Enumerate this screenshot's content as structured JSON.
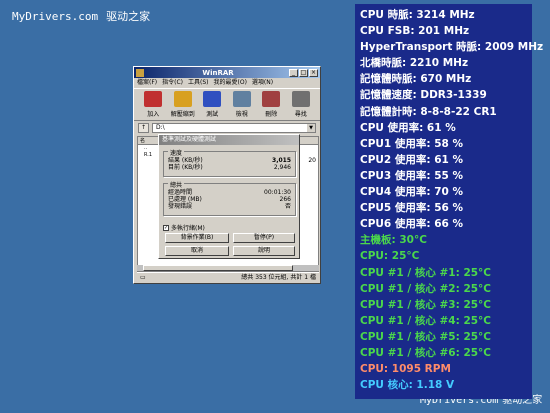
{
  "watermark": {
    "top_url": "MyDrivers.com",
    "top_cn": "驱动之家",
    "bottom_url": "MyDrivers.com",
    "bottom_cn": "驱动之家"
  },
  "winrar": {
    "title": "WinRAR",
    "menu": [
      "檔案(F)",
      "指令(C)",
      "工具(S)",
      "我的最愛(O)",
      "選項(N)"
    ],
    "toolbar": [
      {
        "label": "加入",
        "icon": "add-icon",
        "color": "#c03030"
      },
      {
        "label": "解壓縮到",
        "icon": "extract-icon",
        "color": "#d8a020"
      },
      {
        "label": "測試",
        "icon": "test-icon",
        "color": "#3050c0"
      },
      {
        "label": "檢視",
        "icon": "view-icon",
        "color": "#6080a0"
      },
      {
        "label": "刪除",
        "icon": "delete-icon",
        "color": "#a04040"
      },
      {
        "label": "尋找",
        "icon": "find-icon",
        "color": "#707070"
      }
    ],
    "path": "D:\\",
    "list_header": "名",
    "list_rows": [
      "..",
      "R.1"
    ],
    "right_col": "20",
    "status_left": "",
    "status_right": "總共 353 位元組, 共計 1 檔"
  },
  "benchmark": {
    "title": "基準測試及硬體測試",
    "speed_group": "速度",
    "result_label": "結果 (KB/秒)",
    "result_value": "3,015",
    "current_label": "目前 (KB/秒)",
    "current_value": "2,946",
    "totals_group": "總共",
    "elapsed_label": "經過時間",
    "elapsed_value": "00:01:30",
    "processed_label": "已處理 (MB)",
    "processed_value": "266",
    "errors_label": "發現錯誤",
    "errors_value": "否",
    "multithread_label": "多執行緒(M)",
    "multithread_checked": true,
    "background_button": "背景作業(B)",
    "pause_button": "暫停(P)",
    "cancel_button": "取消",
    "help_button": "說明"
  },
  "stats": [
    {
      "text": "CPU 時脈: 3214 MHz",
      "color": "white"
    },
    {
      "text": "CPU FSB: 201 MHz",
      "color": "white"
    },
    {
      "text": "HyperTransport 時脈: 2009 MHz",
      "color": "white"
    },
    {
      "text": "北橋時脈: 2210 MHz",
      "color": "white"
    },
    {
      "text": "記憶體時脈: 670 MHz",
      "color": "white"
    },
    {
      "text": "記憶體速度: DDR3-1339",
      "color": "white"
    },
    {
      "text": "記憶體計時: 8-8-8-22 CR1",
      "color": "white"
    },
    {
      "text": "CPU 使用率: 61 %",
      "color": "white"
    },
    {
      "text": "CPU1 使用率: 58 %",
      "color": "white"
    },
    {
      "text": "CPU2 使用率: 61 %",
      "color": "white"
    },
    {
      "text": "CPU3 使用率: 55 %",
      "color": "white"
    },
    {
      "text": "CPU4 使用率: 70 %",
      "color": "white"
    },
    {
      "text": "CPU5 使用率: 56 %",
      "color": "white"
    },
    {
      "text": "CPU6 使用率: 66 %",
      "color": "white"
    },
    {
      "text": "主機板: 30°C",
      "color": "green"
    },
    {
      "text": "CPU: 25°C",
      "color": "green"
    },
    {
      "text": "CPU #1 / 核心 #1: 25°C",
      "color": "green"
    },
    {
      "text": "CPU #1 / 核心 #2: 25°C",
      "color": "green"
    },
    {
      "text": "CPU #1 / 核心 #3: 25°C",
      "color": "green"
    },
    {
      "text": "CPU #1 / 核心 #4: 25°C",
      "color": "green"
    },
    {
      "text": "CPU #1 / 核心 #5: 25°C",
      "color": "green"
    },
    {
      "text": "CPU #1 / 核心 #6: 25°C",
      "color": "green"
    },
    {
      "text": "CPU: 1095 RPM",
      "color": "orange"
    },
    {
      "text": "CPU 核心: 1.18 V",
      "color": "cyan"
    }
  ]
}
